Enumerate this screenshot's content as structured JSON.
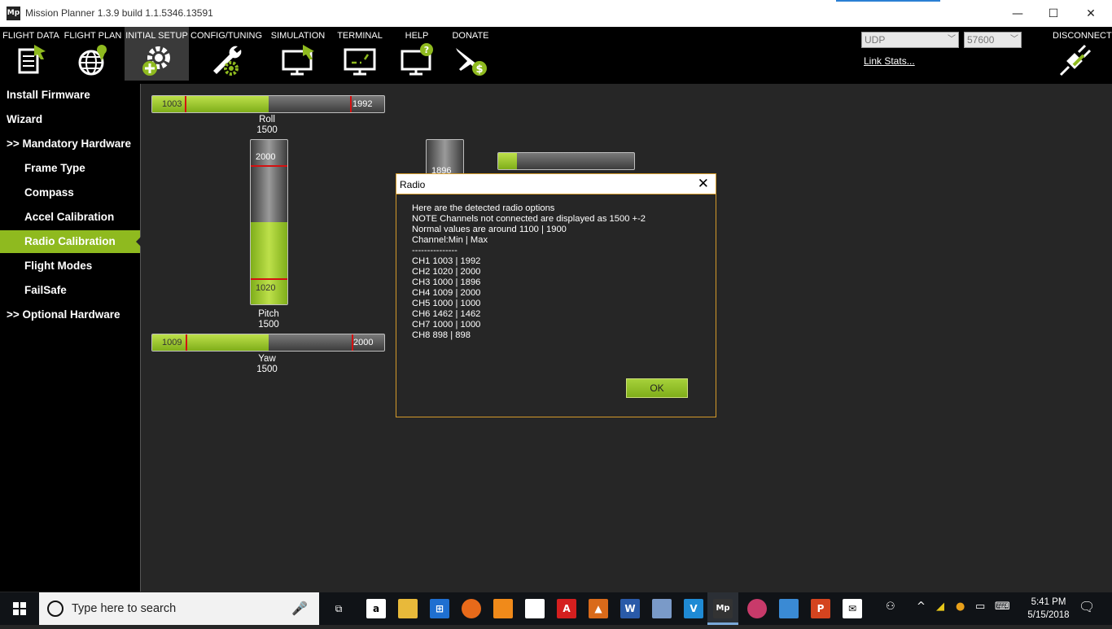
{
  "window": {
    "title": "Mission Planner 1.3.9 build 1.1.5346.13591",
    "app_icon_text": "Mp",
    "minimize": "—",
    "maximize": "☐",
    "close": "✕"
  },
  "menu": {
    "items": [
      {
        "label": "FLIGHT DATA",
        "icon": "flight-data-icon"
      },
      {
        "label": "FLIGHT PLAN",
        "icon": "flight-plan-icon"
      },
      {
        "label": "INITIAL SETUP",
        "icon": "initial-setup-icon"
      },
      {
        "label": "CONFIG/TUNING",
        "icon": "config-tuning-icon"
      },
      {
        "label": "SIMULATION",
        "icon": "simulation-icon"
      },
      {
        "label": "TERMINAL",
        "icon": "terminal-icon"
      },
      {
        "label": "HELP",
        "icon": "help-icon"
      },
      {
        "label": "DONATE",
        "icon": "donate-icon"
      }
    ],
    "active": "INITIAL SETUP",
    "connection_type": "UDP",
    "baud_rate": "57600",
    "link_stats": "Link Stats...",
    "disconnect": "DISCONNECT"
  },
  "sidebar": {
    "items": [
      {
        "label": "Install Firmware"
      },
      {
        "label": "Wizard"
      },
      {
        "label": ">> Mandatory Hardware"
      },
      {
        "label": "Frame Type"
      },
      {
        "label": "Compass"
      },
      {
        "label": "Accel Calibration"
      },
      {
        "label": "Radio Calibration"
      },
      {
        "label": "Flight Modes"
      },
      {
        "label": "FailSafe"
      },
      {
        "label": ">> Optional Hardware"
      }
    ],
    "active": "Radio Calibration"
  },
  "channels": {
    "roll": {
      "name": "Roll",
      "value": "1500",
      "min": "1003",
      "max": "1992",
      "fill": 0.5
    },
    "pitch": {
      "name": "Pitch",
      "value": "1500",
      "min": "1020",
      "max": "2000",
      "fill": 0.5
    },
    "yaw": {
      "name": "Yaw",
      "value": "1500",
      "min": "1009",
      "max": "2000",
      "fill": 0.5
    },
    "throttle": {
      "max": "1896"
    },
    "ch5": {
      "fill": 0.14
    }
  },
  "dialog": {
    "title": "Radio",
    "close": "✕",
    "message": "Here are the detected radio options\nNOTE Channels not connected are displayed as 1500 +-2\nNormal values are around 1100 | 1900\nChannel:Min | Max\n---------------\nCH1 1003 | 1992\nCH2 1020 | 2000\nCH3 1000 | 1896\nCH4 1009 | 2000\nCH5 1000 | 1000\nCH6 1462 | 1462\nCH7 1000 | 1000\nCH8 898 | 898",
    "ok_label": "OK"
  },
  "taskbar": {
    "search_placeholder": "Type here to search",
    "mp_text": "Mp",
    "time": "5:41 PM",
    "date": "5/15/2018"
  }
}
